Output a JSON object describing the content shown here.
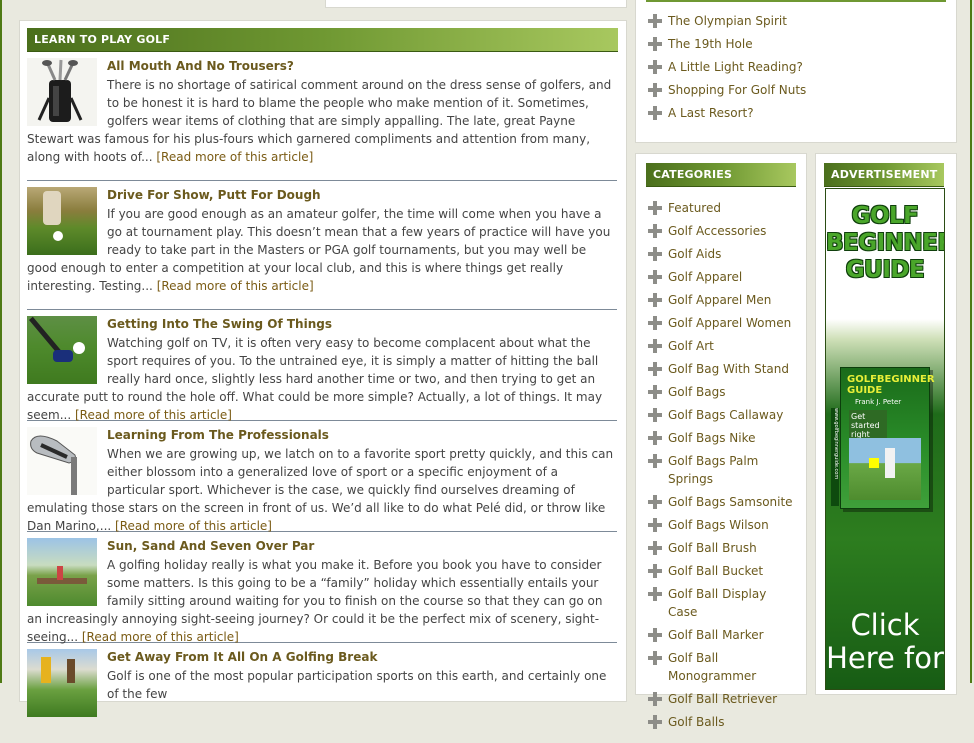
{
  "main": {
    "section_title": "LEARN TO PLAY GOLF",
    "articles": [
      {
        "title": "All Mouth And No Trousers?",
        "text": "There is no shortage of satirical comment around on the dress sense of golfers, and to be honest it is hard to blame the people who make mention of it. Sometimes, golfers wear items of clothing that are simply appalling. The late, great Payne Stewart was famous for his plus-fours which garnered compliments and attention from many, along with hoots of...",
        "more": "[Read more of this article]"
      },
      {
        "title": "Drive For Show, Putt For Dough",
        "text": "If you are good enough as an amateur golfer, the time will come when you have a go at tournament play. This doesn’t mean that a few years of practice will have you ready to take part in the Masters or PGA golf tournaments, but you may well be good enough to enter a competition at your local club, and this is where things get really interesting. Testing...",
        "more": "[Read more of this article]"
      },
      {
        "title": "Getting Into The Swing Of Things",
        "text": "Watching golf on TV, it is often very easy to become complacent about what the sport requires of you. To the untrained eye, it is simply a matter of hitting the ball really hard once, slightly less hard another time or two, and then trying to get an accurate putt to round the hole off. What could be more simple? Actually, a lot of things. It may seem...",
        "more": "[Read more of this article]"
      },
      {
        "title": "Learning From The Professionals",
        "text": "When we are growing up, we latch on to a favorite sport pretty quickly, and this can either blossom into a generalized love of sport or a specific enjoyment of a particular sport. Whichever is the case, we quickly find ourselves dreaming of emulating those stars on the screen in front of us. We’d all like to do what Pelé did, or throw like Dan Marino,...",
        "more": "[Read more of this article]"
      },
      {
        "title": "Sun, Sand And Seven Over Par",
        "text": "A golfing holiday really is what you make it. Before you book you have to consider some matters. Is this going to be a “family” holiday which essentially entails your family sitting around waiting for you to finish on the course so that they can go on an increasingly annoying sight-seeing journey? Or could it be the perfect mix of scenery, sight-seeing...",
        "more": "[Read more of this article]"
      },
      {
        "title": "Get Away From It All On A Golfing Break",
        "text": "Golf is one of the most popular participation sports on this earth, and certainly one of the few",
        "more": ""
      }
    ]
  },
  "recent": {
    "items": [
      "The Olympian Spirit",
      "The 19th Hole",
      "A Little Light Reading?",
      "Shopping For Golf Nuts",
      "A Last Resort?"
    ]
  },
  "categories": {
    "title": "CATEGORIES",
    "items": [
      "Featured",
      "Golf Accessories",
      "Golf Aids",
      "Golf Apparel",
      "Golf Apparel Men",
      "Golf Apparel Women",
      "Golf Art",
      "Golf Bag With Stand",
      "Golf Bags",
      "Golf Bags Callaway",
      "Golf Bags Nike",
      "Golf Bags Palm Springs",
      "Golf Bags Samsonite",
      "Golf Bags Wilson",
      "Golf Ball Brush",
      "Golf Ball Bucket",
      "Golf Ball Display Case",
      "Golf Ball Marker",
      "Golf Ball Monogrammer",
      "Golf Ball Retriever",
      "Golf Balls"
    ]
  },
  "advertisement": {
    "title": "ADVERTISEMENT",
    "ad_title": "GOLF BEGINNER GUIDE",
    "book_title": "GOLFBEGINNER GUIDE",
    "book_author": "Frank J. Peter",
    "book_sub": "Get started right",
    "book_spine": "www.golfbeginnerguide.com",
    "click_text": "Click Here for"
  },
  "icons": [
    "golf-bag-icon",
    "plus-icon"
  ],
  "colors": {
    "accent_green": "#5d8a22",
    "link_brown": "#6b5a1e"
  }
}
